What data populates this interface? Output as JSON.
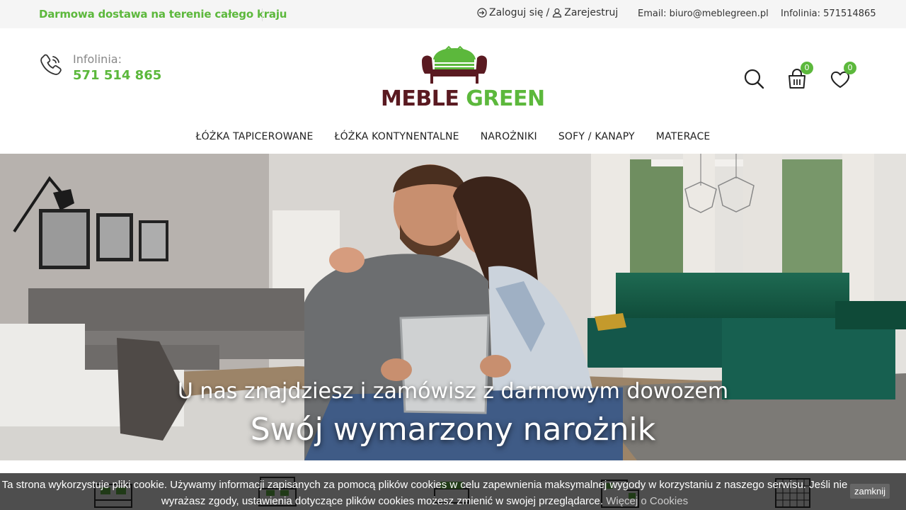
{
  "topbar": {
    "promo": "Darmowa dostawa na terenie całego kraju",
    "login": "Zaloguj się",
    "slash": "/",
    "register": "Zarejestruj",
    "email": "Email: biuro@meblegreen.pl",
    "hotline": "Infolinia: 571514865"
  },
  "header": {
    "hotline_label": "Infolinia:",
    "hotline_number": "571 514 865",
    "logo_word1": "MEBLE",
    "logo_word2": "GREEN",
    "cart_count": "0",
    "wishlist_count": "0"
  },
  "nav": {
    "items": [
      "ŁÓŻKA TAPICEROWANE",
      "ŁÓŻKA KONTYNENTALNE",
      "NAROŻNIKI",
      "SOFY / KANAPY",
      "MATERACE"
    ]
  },
  "hero": {
    "caption1": "U nas znajdziesz i zamówisz z darmowym dowozem",
    "caption2": "Swój wymarzony narożnik"
  },
  "cookie": {
    "line1": "Ta strona wykorzystuje pliki cookie. Używamy informacji zapisanych za pomocą plików cookies w celu zapewnienia maksymalnej wygody w korzystaniu z naszego serwisu. Jeśli nie",
    "line2": "wyrażasz zgody, ustawienia dotyczące plików cookies możesz zmienić w swojej przeglądarce.",
    "link": "Więcej o Cookies",
    "close": "zamknij"
  },
  "colors": {
    "brand_green": "#5cb83c",
    "brand_maroon": "#5a1a21"
  }
}
